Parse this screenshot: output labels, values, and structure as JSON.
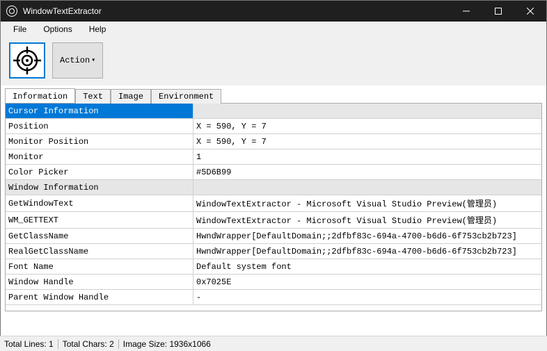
{
  "window": {
    "title": "WindowTextExtractor"
  },
  "menu": {
    "file": "File",
    "options": "Options",
    "help": "Help"
  },
  "toolbar": {
    "action_label": "Action"
  },
  "tabs": {
    "information": "Information",
    "text": "Text",
    "image": "Image",
    "environment": "Environment"
  },
  "grid": {
    "sec_cursor": "Cursor Information",
    "position_k": "Position",
    "position_v": "X = 590, Y = 7",
    "monitorpos_k": "Monitor Position",
    "monitorpos_v": "X = 590, Y = 7",
    "monitor_k": "Monitor",
    "monitor_v": "1",
    "color_k": "Color Picker",
    "color_v": "#5D6B99",
    "sec_window": "Window Information",
    "gwt_k": "GetWindowText",
    "gwt_v": "WindowTextExtractor - Microsoft Visual Studio Preview(管理员)",
    "wmg_k": "WM_GETTEXT",
    "wmg_v": "WindowTextExtractor - Microsoft Visual Studio Preview(管理员)",
    "gcn_k": "GetClassName",
    "gcn_v": "HwndWrapper[DefaultDomain;;2dfbf83c-694a-4700-b6d6-6f753cb2b723]",
    "rgcn_k": "RealGetClassName",
    "rgcn_v": "HwndWrapper[DefaultDomain;;2dfbf83c-694a-4700-b6d6-6f753cb2b723]",
    "font_k": "Font Name",
    "font_v": "Default system font",
    "wh_k": "Window Handle",
    "wh_v": "0x7025E",
    "pwh_k": "Parent Window Handle",
    "pwh_v": "-"
  },
  "status": {
    "lines": "Total Lines: 1",
    "chars": "Total Chars: 2",
    "imgsize": "Image Size: 1936x1066"
  }
}
